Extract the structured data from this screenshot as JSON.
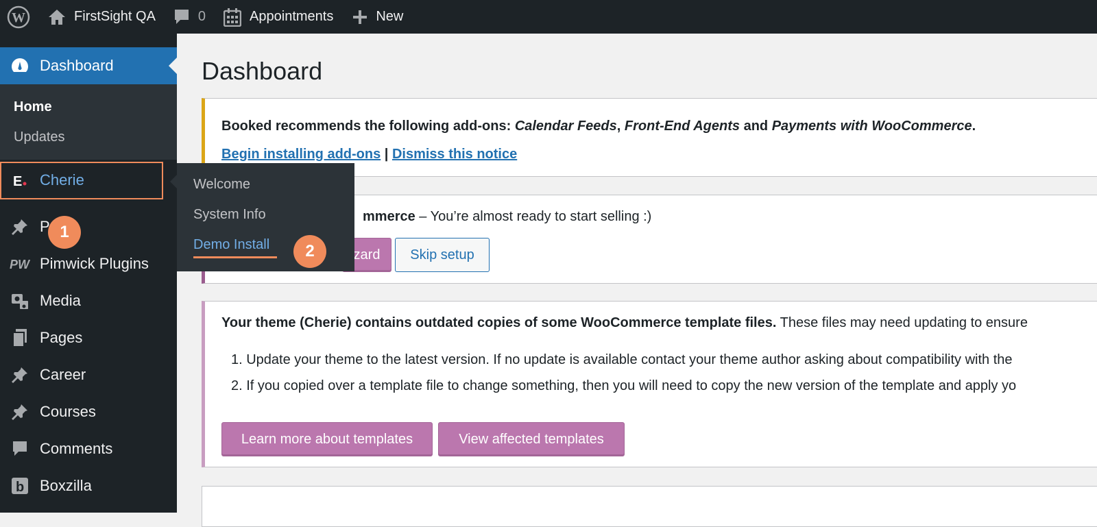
{
  "admin_bar": {
    "site_name": "FirstSight QA",
    "comments_count": "0",
    "appointments_label": "Appointments",
    "new_label": "New",
    "icons": [
      "wordpress-logo-icon",
      "home-icon",
      "comment-icon",
      "calendar-icon",
      "plus-icon"
    ]
  },
  "sidebar": {
    "dashboard_label": "Dashboard",
    "dashboard_submenu": [
      "Home",
      "Updates"
    ],
    "cherie_label": "Cherie",
    "items": [
      {
        "label": "P",
        "icon": "pin-icon"
      },
      {
        "label": "Pimwick Plugins",
        "icon": "pw-icon"
      },
      {
        "label": "Media",
        "icon": "media-icon"
      },
      {
        "label": "Pages",
        "icon": "pages-icon"
      },
      {
        "label": "Career",
        "icon": "pin-icon"
      },
      {
        "label": "Courses",
        "icon": "pin-icon"
      },
      {
        "label": "Comments",
        "icon": "comment-icon"
      },
      {
        "label": "Boxzilla",
        "icon": "boxzilla-icon"
      }
    ]
  },
  "flyout": {
    "items": [
      "Welcome",
      "System Info",
      "Demo Install"
    ]
  },
  "badges": {
    "step1": "1",
    "step2": "2"
  },
  "main": {
    "title": "Dashboard",
    "booked_notice": {
      "prefix": "Booked recommends the following add-ons: ",
      "addon1": "Calendar Feeds",
      "sep1": ", ",
      "addon2": "Front-End Agents",
      "sep2": " and ",
      "addon3": "Payments with WooCommerce",
      "end": ".",
      "link_install": "Begin installing add-ons",
      "pipe": " | ",
      "link_dismiss": "Dismiss this notice"
    },
    "woo_notice": {
      "bold_tail": "mmerce",
      "rest": " – You’re almost ready to start selling :)",
      "wizard_tail": "zard",
      "skip_label": "Skip setup"
    },
    "templates_notice": {
      "bold": "Your theme (Cherie) contains outdated copies of some WooCommerce template files.",
      "rest": " These files may need updating to ensure",
      "item1": "1. Update your theme to the latest version. If no update is available contact your theme author asking about compatibility with the",
      "item2": "2. If you copied over a template file to change something, then you will need to copy the new version of the template and apply yo",
      "btn_learn": "Learn more about templates",
      "btn_view": "View affected templates"
    }
  }
}
